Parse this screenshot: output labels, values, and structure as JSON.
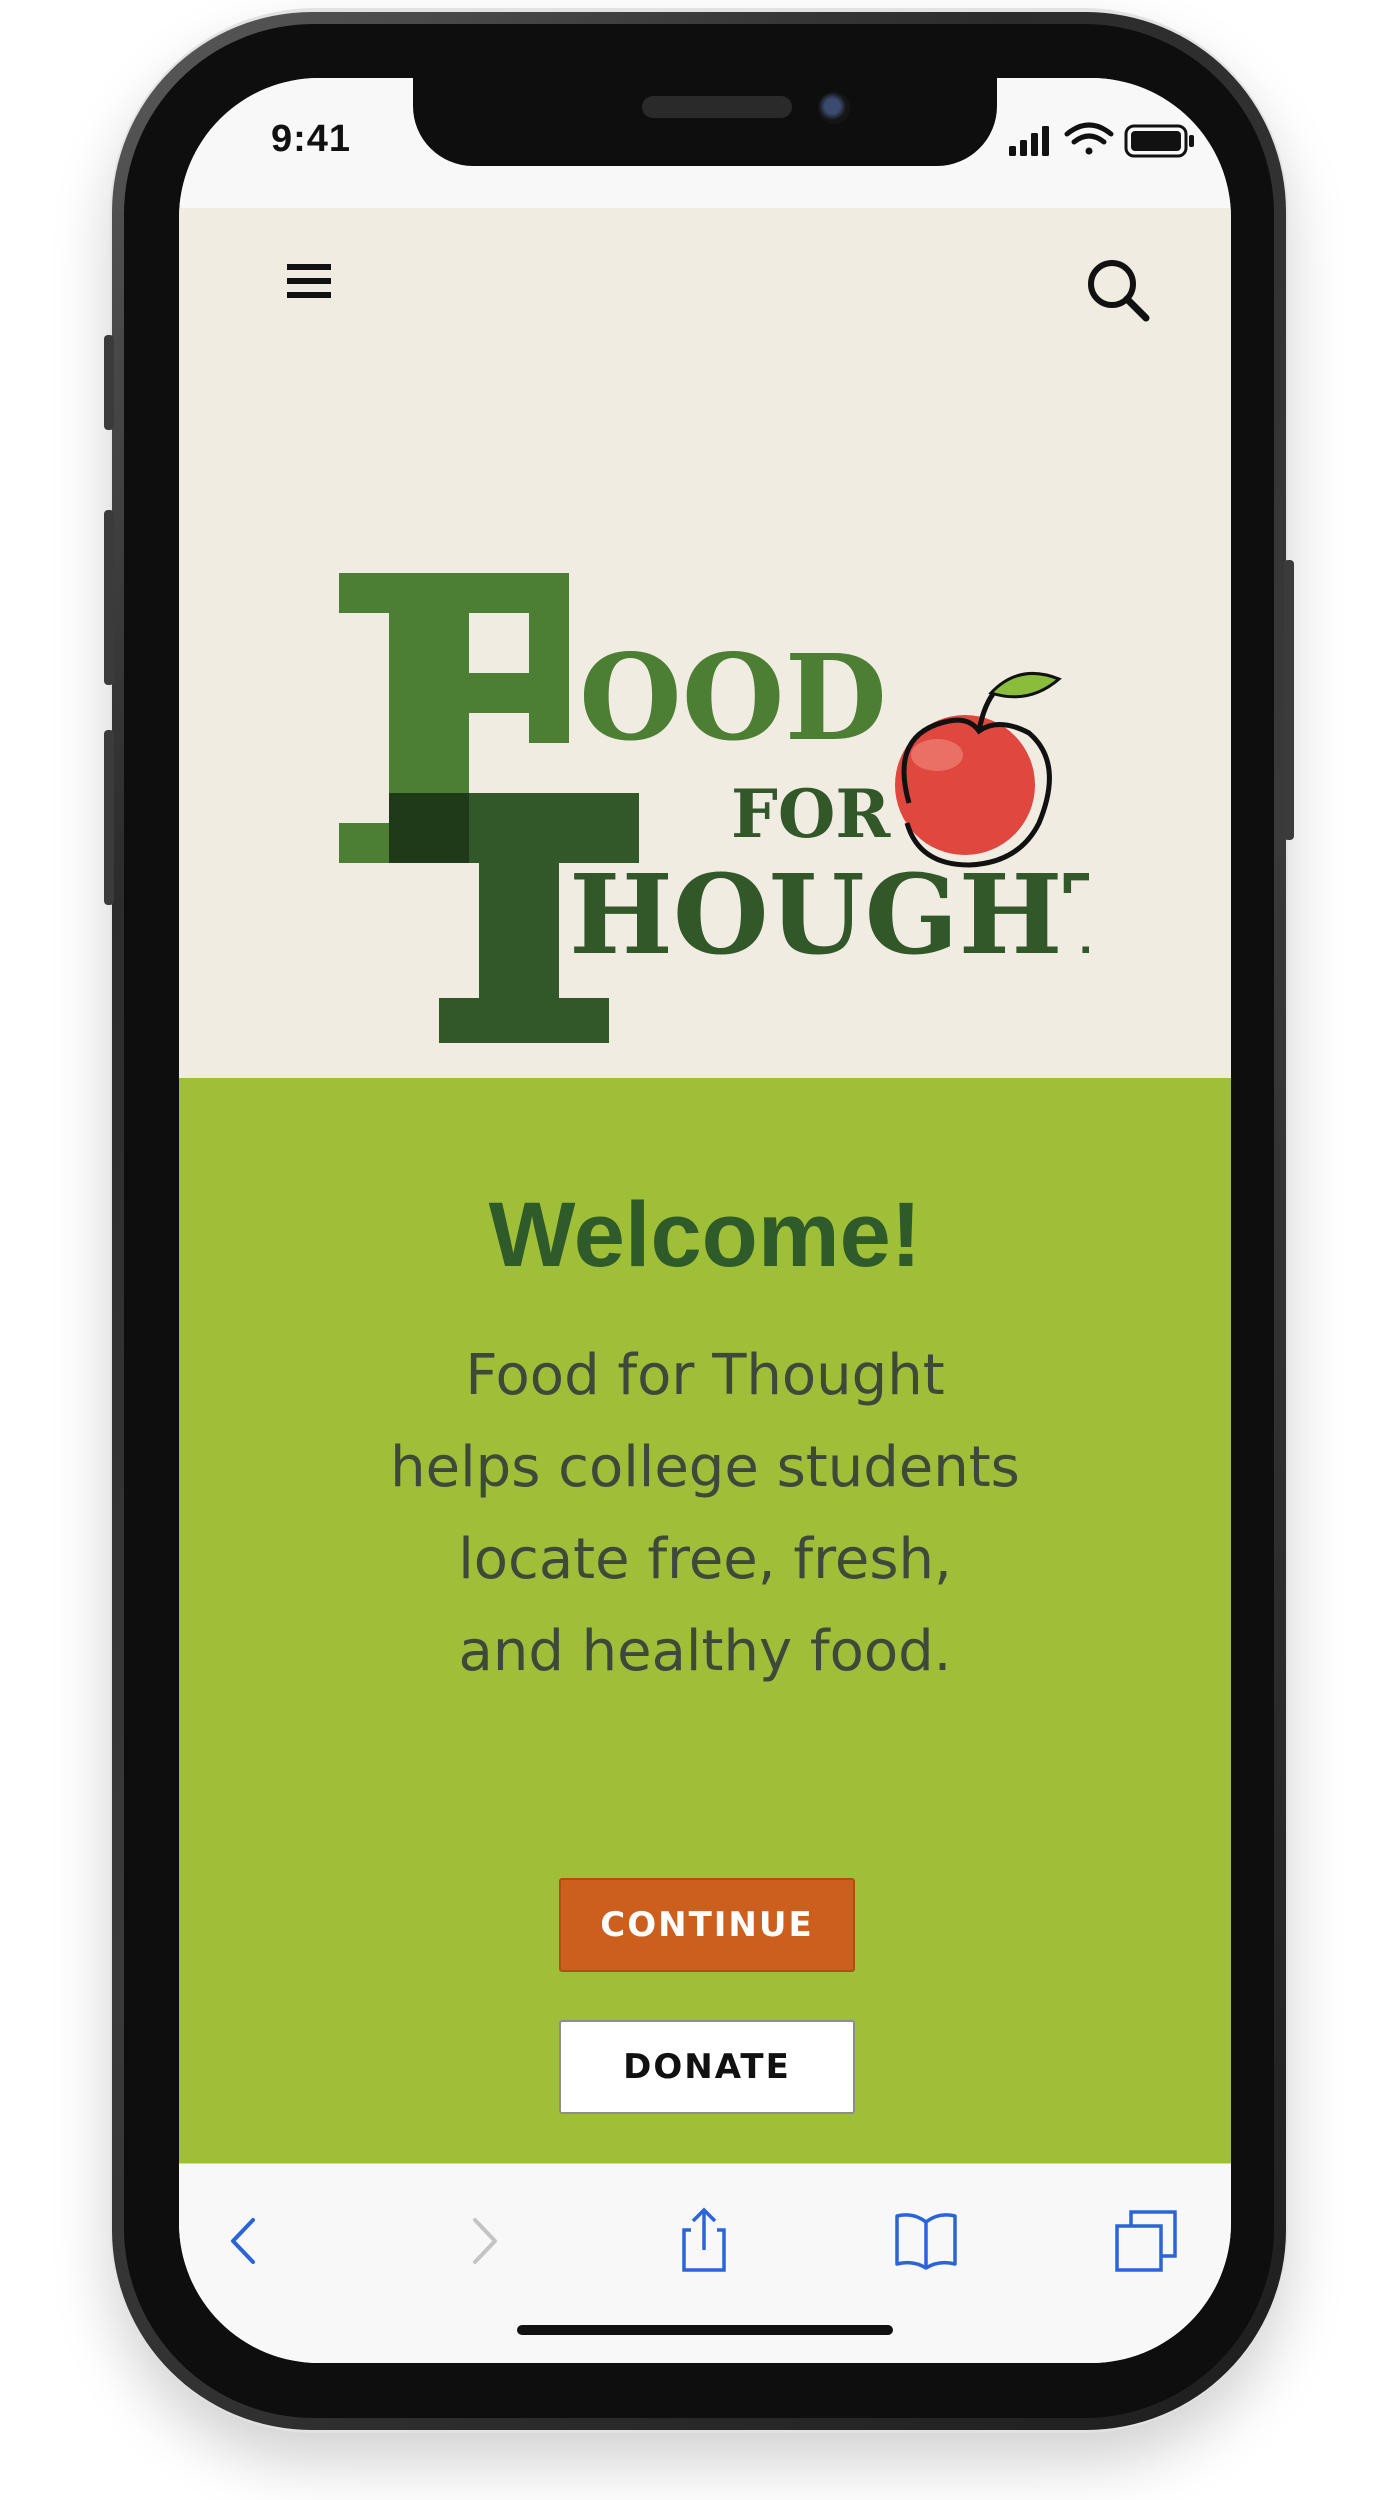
{
  "status_bar": {
    "time": "9:41",
    "icons": [
      "cellular-signal-icon",
      "wifi-icon",
      "battery-icon"
    ]
  },
  "header": {
    "menu_icon": "hamburger-menu-icon",
    "search_icon": "search-icon"
  },
  "logo": {
    "line1": "FOOD",
    "line2": "FOR",
    "line3": "THOUGHT",
    "icon": "apple-icon",
    "colors": {
      "green_light": "#4c7f34",
      "green_dark": "#325729",
      "apple_red": "#e0473e"
    }
  },
  "welcome": {
    "title": "Welcome!",
    "body_lines": [
      "Food for Thought",
      "helps college students",
      "locate free, fresh,",
      "and healthy food."
    ],
    "continue_label": "CONTINUE",
    "donate_label": "DONATE"
  },
  "browser_toolbar": {
    "items": [
      "back-icon",
      "forward-icon",
      "share-icon",
      "bookmarks-icon",
      "tabs-icon"
    ],
    "accent": "#2a64d8"
  },
  "colors": {
    "page_background": "#f1ece2",
    "panel_green": "#a0bf39",
    "title_green": "#2f5a2a",
    "continue_orange": "#cc5f1e"
  }
}
